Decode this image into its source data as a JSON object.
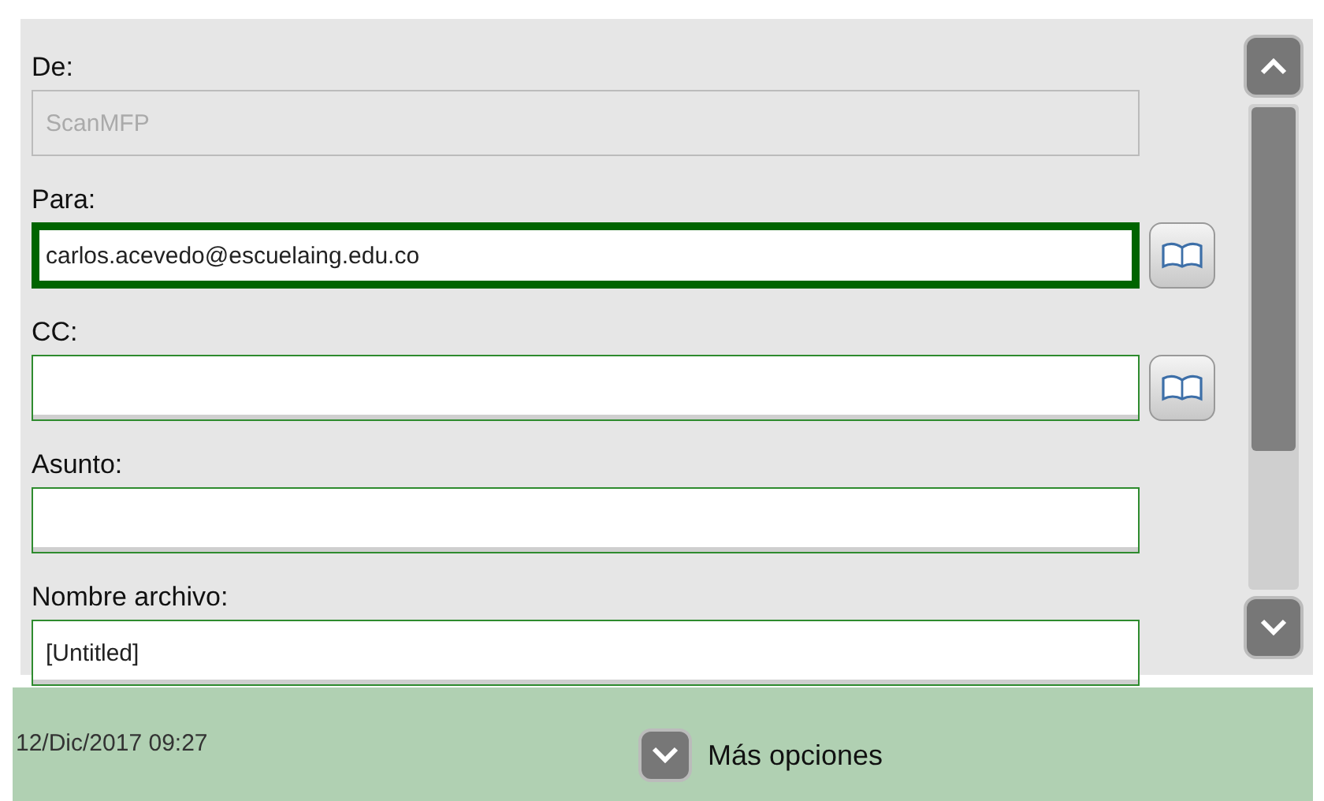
{
  "fields": [
    {
      "label": "De:",
      "value": "ScanMFP",
      "kind": "plain",
      "disabled": true,
      "focused": false
    },
    {
      "label": "Para:",
      "value": "carlos.acevedo@escuelaing.edu.co",
      "kind": "address",
      "disabled": false,
      "focused": true
    },
    {
      "label": "CC:",
      "kind": "address",
      "disabled": false,
      "focused": false
    },
    {
      "label": "Asunto:",
      "kind": "plain",
      "disabled": false,
      "focused": false
    },
    {
      "label": "Nombre archivo:",
      "value": "[Untitled]",
      "kind": "plain",
      "disabled": false,
      "focused": false
    }
  ],
  "status_bar": {
    "datetime": "12/Dic/2017 09:27",
    "more_button": "Más opciones"
  }
}
